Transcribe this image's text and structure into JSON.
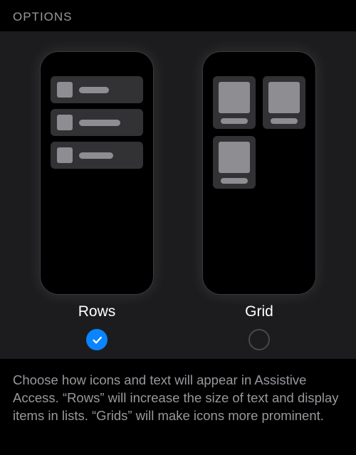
{
  "header": {
    "title": "OPTIONS"
  },
  "options": {
    "rows": {
      "label": "Rows",
      "selected": true
    },
    "grid": {
      "label": "Grid",
      "selected": false
    }
  },
  "description": "Choose how icons and text will appear in Assistive Access. “Rows” will increase the size of text and display items in lists. “Grids” will make icons more prominent."
}
